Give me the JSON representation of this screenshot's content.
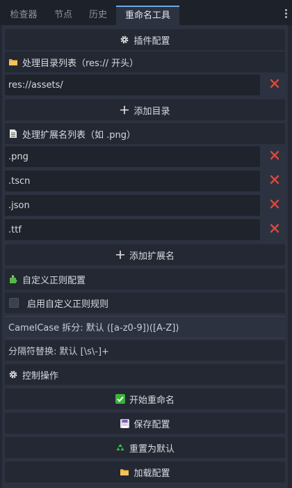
{
  "tabs": [
    {
      "label": "检查器"
    },
    {
      "label": "节点"
    },
    {
      "label": "历史"
    },
    {
      "label": "重命名工具"
    }
  ],
  "plugin_config_label": "插件配置",
  "dirs": {
    "header": "处理目录列表（res:// 开头）",
    "items": [
      "res://assets/"
    ],
    "add_label": "添加目录"
  },
  "exts": {
    "header": "处理扩展名列表（如 .png）",
    "items": [
      ".png",
      ".tscn",
      ".json",
      ".ttf"
    ],
    "add_label": "添加扩展名"
  },
  "regex": {
    "header": "自定义正则配置",
    "enable_label": "启用自定义正则规则",
    "enabled": false,
    "camelcase": "CamelCase 拆分: 默认 ([a-z0-9])([A-Z])",
    "separator": "分隔符替换: 默认 [\\s\\-]+"
  },
  "control": {
    "header": "控制操作",
    "start_label": "开始重命名",
    "save_label": "保存配置",
    "reset_label": "重置为默认",
    "load_label": "加载配置"
  },
  "colors": {
    "accent": "#6fa8e6",
    "delete": "#e0463c",
    "check_green": "#3bb33b"
  }
}
